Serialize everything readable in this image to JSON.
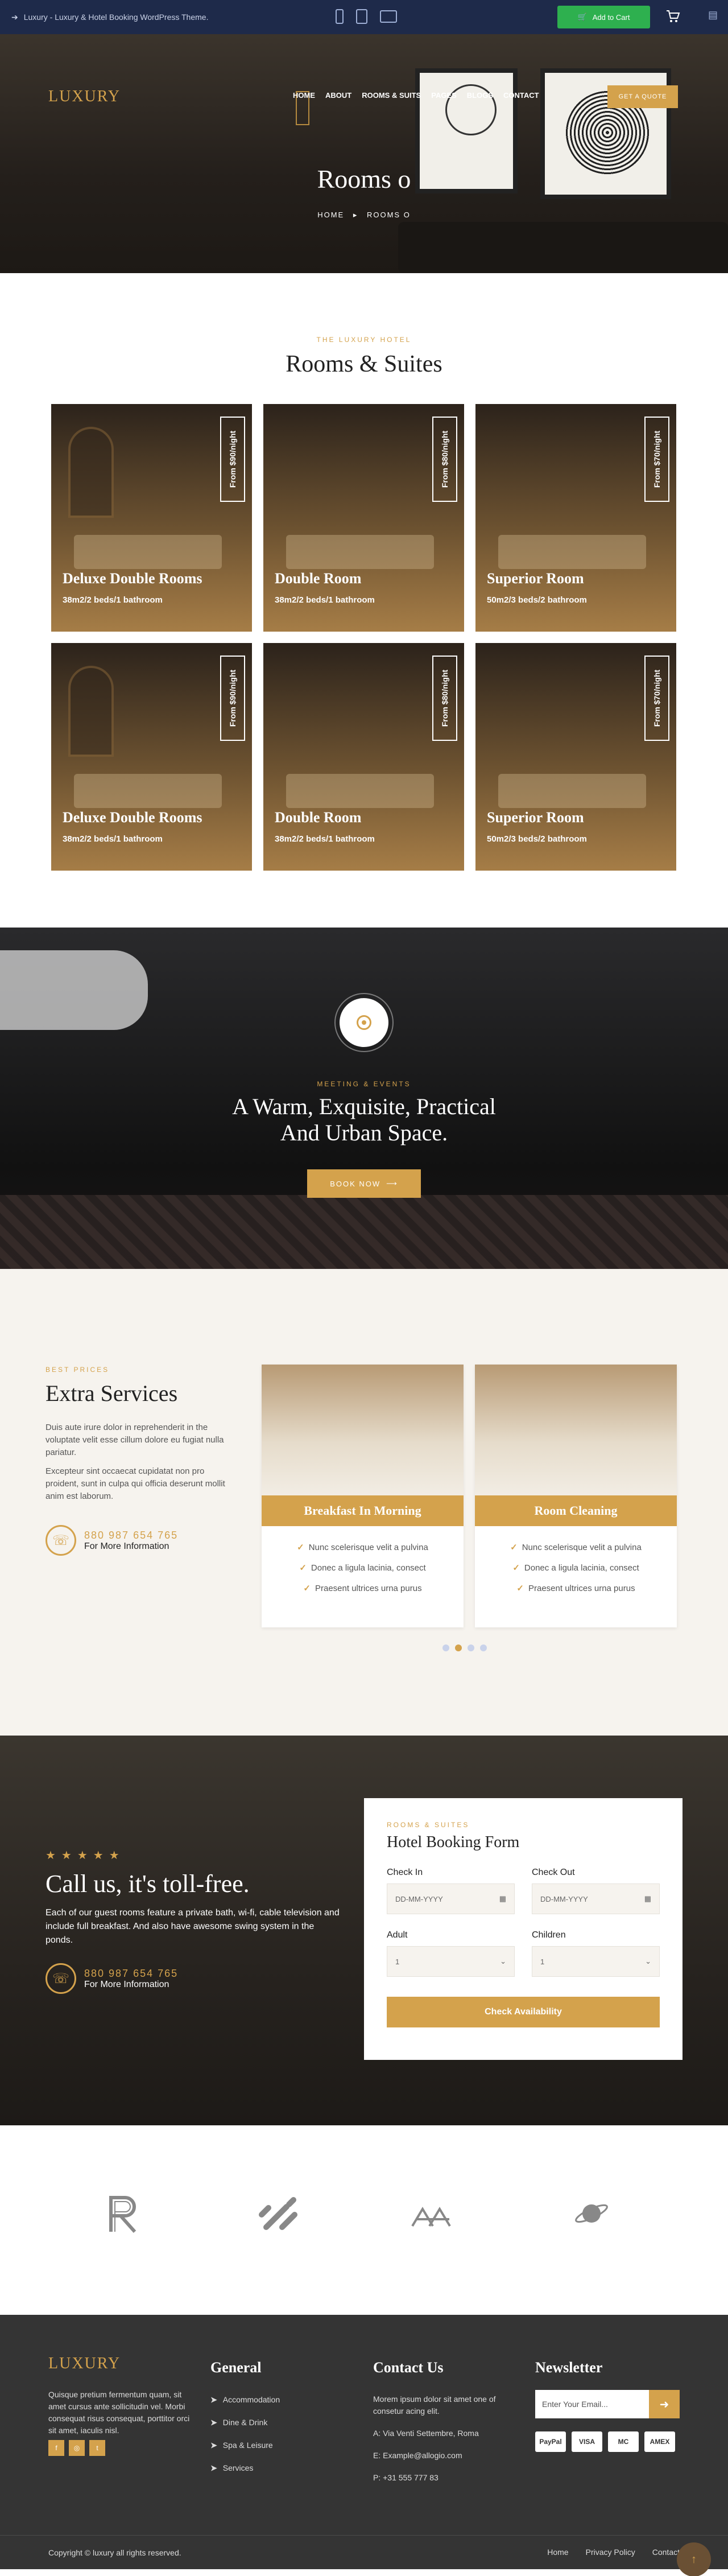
{
  "preview": {
    "title": "Luxury - Luxury & Hotel Booking WordPress Theme.",
    "cart_label": "Add to Cart"
  },
  "nav": {
    "logo": "LUXURY",
    "items": [
      "HOME",
      "ABOUT",
      "ROOMS & SUITS",
      "PAGES",
      "BLOGS",
      "CONTACT"
    ],
    "quote": "GET A QUOTE"
  },
  "hero": {
    "title": "Rooms o",
    "crumb_home": "HOME",
    "crumb_current": "ROOMS O"
  },
  "rooms_section": {
    "kicker": "THE LUXURY HOTEL",
    "title": "Rooms & Suites",
    "rooms": [
      {
        "name": "Deluxe Double Rooms",
        "meta": "38m2/2 beds/1 bathroom",
        "price": "From $90/night"
      },
      {
        "name": "Double Room",
        "meta": "38m2/2 beds/1 bathroom",
        "price": "From $80/night"
      },
      {
        "name": "Superior Room",
        "meta": "50m2/3 beds/2 bathroom",
        "price": "From $70/night"
      },
      {
        "name": "Deluxe Double Rooms",
        "meta": "38m2/2 beds/1 bathroom",
        "price": "From $90/night"
      },
      {
        "name": "Double Room",
        "meta": "38m2/2 beds/1 bathroom",
        "price": "From $80/night"
      },
      {
        "name": "Superior Room",
        "meta": "50m2/3 beds/2 bathroom",
        "price": "From $70/night"
      }
    ]
  },
  "events": {
    "kicker": "MEETING & EVENTS",
    "title_line1": "A Warm, Exquisite, Practical",
    "title_line2": "And Urban Space.",
    "button": "BOOK NOW"
  },
  "services": {
    "kicker": "BEST PRICES",
    "title": "Extra Services",
    "p1": "Duis aute irure dolor in reprehenderit in the voluptate velit esse cillum dolore eu fugiat nulla pariatur.",
    "p2": "Excepteur sint occaecat cupidatat non pro proident, sunt in culpa qui officia deserunt mollit anim est laborum.",
    "phone": "880 987 654 765",
    "phone_more": "For More Information",
    "cards": [
      {
        "label": "Breakfast In Morning",
        "items": [
          "Nunc scelerisque velit a pulvina",
          "Donec a ligula lacinia, consect",
          "Praesent ultrices urna purus"
        ]
      },
      {
        "label": "Room Cleaning",
        "items": [
          "Nunc scelerisque velit a pulvina",
          "Donec a ligula lacinia, consect",
          "Praesent ultrices urna purus"
        ]
      }
    ]
  },
  "booking": {
    "title": "Call us, it's toll-free.",
    "text": "Each of our guest rooms feature a private bath, wi-fi, cable television and include full breakfast. And also have awesome swing system in the ponds.",
    "phone": "880 987 654 765",
    "phone_more": "For More Information",
    "form": {
      "kicker": "ROOMS & SUITES",
      "title": "Hotel Booking Form",
      "check_in_label": "Check In",
      "check_out_label": "Check Out",
      "date_placeholder": "DD-MM-YYYY",
      "adult_label": "Adult",
      "children_label": "Children",
      "adult_value": "1",
      "children_value": "1",
      "submit": "Check Availability"
    }
  },
  "footer": {
    "logo": "LUXURY",
    "about": "Quisque pretium fermentum quam, sit amet cursus ante sollicitudin vel. Morbi consequat risus consequat, porttitor orci sit amet, iaculis nisl.",
    "general_title": "General",
    "links": [
      "Accommodation",
      "Dine & Drink",
      "Spa & Leisure",
      "Services"
    ],
    "contact_title": "Contact Us",
    "contact_text": "Morem ipsum dolor sit amet one of consetur acing elit.",
    "address": "A: Via Venti Settembre, Roma",
    "email": "E: Example@allogio.com",
    "phone": "P: +31 555 777 83",
    "newsletter_title": "Newsletter",
    "newsletter_placeholder": "Enter Your Email...",
    "payments": [
      "PayPal",
      "VISA",
      "MC",
      "AMEX"
    ],
    "copyright": "Copyright © luxury all rights reserved.",
    "bottom_links": [
      "Home",
      "Privacy Policy",
      "Contact"
    ]
  },
  "colors": {
    "accent": "#d4a24c",
    "preview_bar": "#1e2a4a",
    "cart": "#2eb04f",
    "footer": "#343434"
  },
  "icons": [
    "arrow-icon",
    "phone-icon",
    "desktop-icon",
    "tablet-icon",
    "cart-icon",
    "menu-icon",
    "play-icon",
    "calendar-icon",
    "chevron-down-icon",
    "check-icon",
    "send-icon",
    "facebook-icon",
    "instagram-icon",
    "twitter-icon",
    "arrow-up-icon"
  ]
}
